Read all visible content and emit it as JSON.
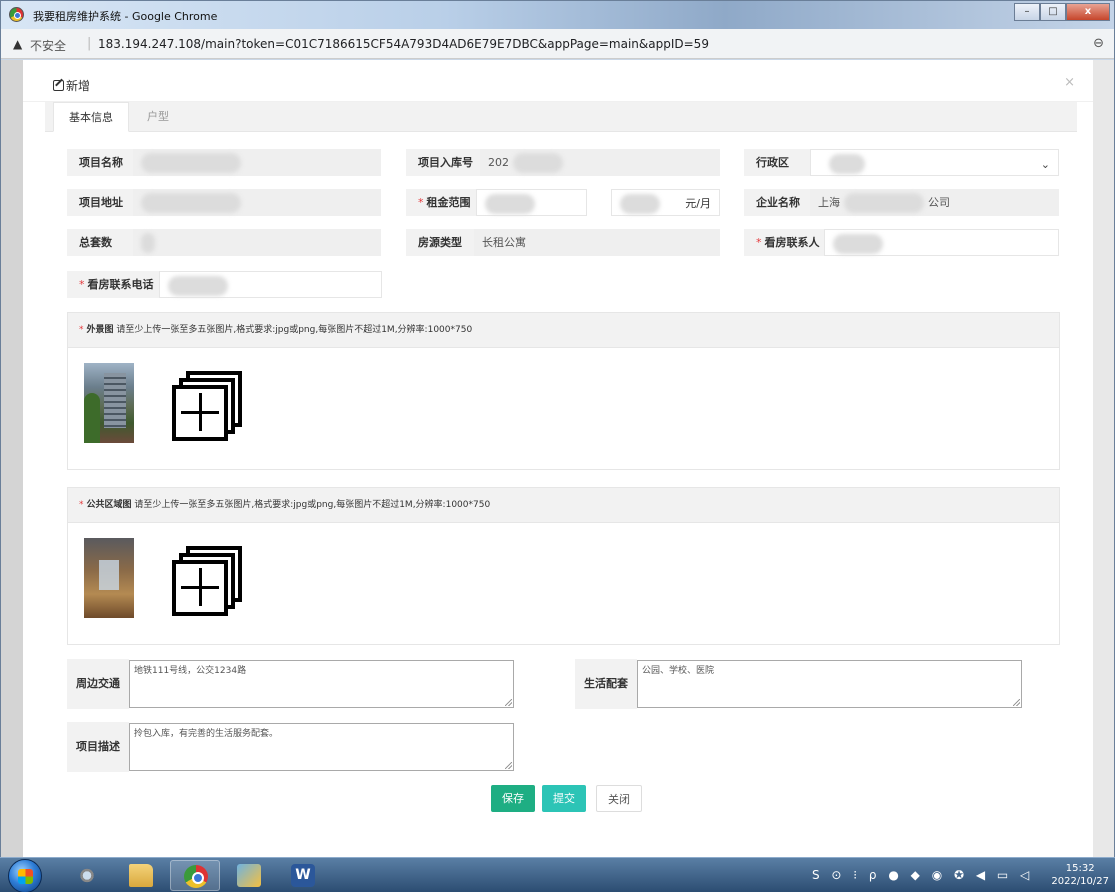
{
  "browser": {
    "window_title": "我要租房维护系统 - Google Chrome",
    "warning_icon": "▲",
    "insecure_label": "不安全",
    "separator": "|",
    "url": "183.194.247.108/main?token=C01C7186615CF54A793D4AD6E79E7DBC&appPage=main&appID=59",
    "zoom_icon": "⊖",
    "controls": {
      "minimize": "–",
      "maximize": "□",
      "close": "x"
    }
  },
  "modal": {
    "title": "新增",
    "close_icon": "×",
    "tabs": [
      {
        "label": "基本信息",
        "active": true
      },
      {
        "label": "户型",
        "active": false
      }
    ]
  },
  "form": {
    "project_name": {
      "label": "项目名称",
      "value": ""
    },
    "project_code": {
      "label": "项目入库号",
      "value": "202"
    },
    "district": {
      "label": "行政区",
      "value": ""
    },
    "project_address": {
      "label": "项目地址",
      "value": ""
    },
    "rent_range": {
      "label": "租金范围",
      "required": "*",
      "unit": "元/月"
    },
    "company_name": {
      "label": "企业名称",
      "value_prefix": "上海",
      "value_suffix": "公司"
    },
    "total_units": {
      "label": "总套数",
      "value": ""
    },
    "housing_type": {
      "label": "房源类型",
      "value": "长租公寓"
    },
    "viewing_contact": {
      "label": "看房联系人",
      "required": "*",
      "value": ""
    },
    "viewing_phone": {
      "label": "看房联系电话",
      "required": "*",
      "value": ""
    }
  },
  "uploads": {
    "exterior": {
      "required": "*",
      "label": "外景图",
      "hint": "请至少上传一张至多五张图片,格式要求:jpg或png,每张图片不超过1M,分辨率:1000*750"
    },
    "public_area": {
      "required": "*",
      "label": "公共区域图",
      "hint": "请至少上传一张至多五张图片,格式要求:jpg或png,每张图片不超过1M,分辨率:1000*750"
    }
  },
  "text_areas": {
    "transport": {
      "label": "周边交通",
      "value": "地铁111号线，公交1234路"
    },
    "amenities": {
      "label": "生活配套",
      "value": "公园、学校、医院"
    },
    "description": {
      "label": "项目描述",
      "value": "拎包入库，有完善的生活服务配套。"
    }
  },
  "actions": {
    "save": "保存",
    "submit": "提交",
    "close": "关闭"
  },
  "taskbar": {
    "tray_icons": "S ⊙ ⁝ ρ ● ◆ ◉ ✪ ◀ ▭ ◁",
    "time": "15:32",
    "date": "2022/10/27"
  }
}
